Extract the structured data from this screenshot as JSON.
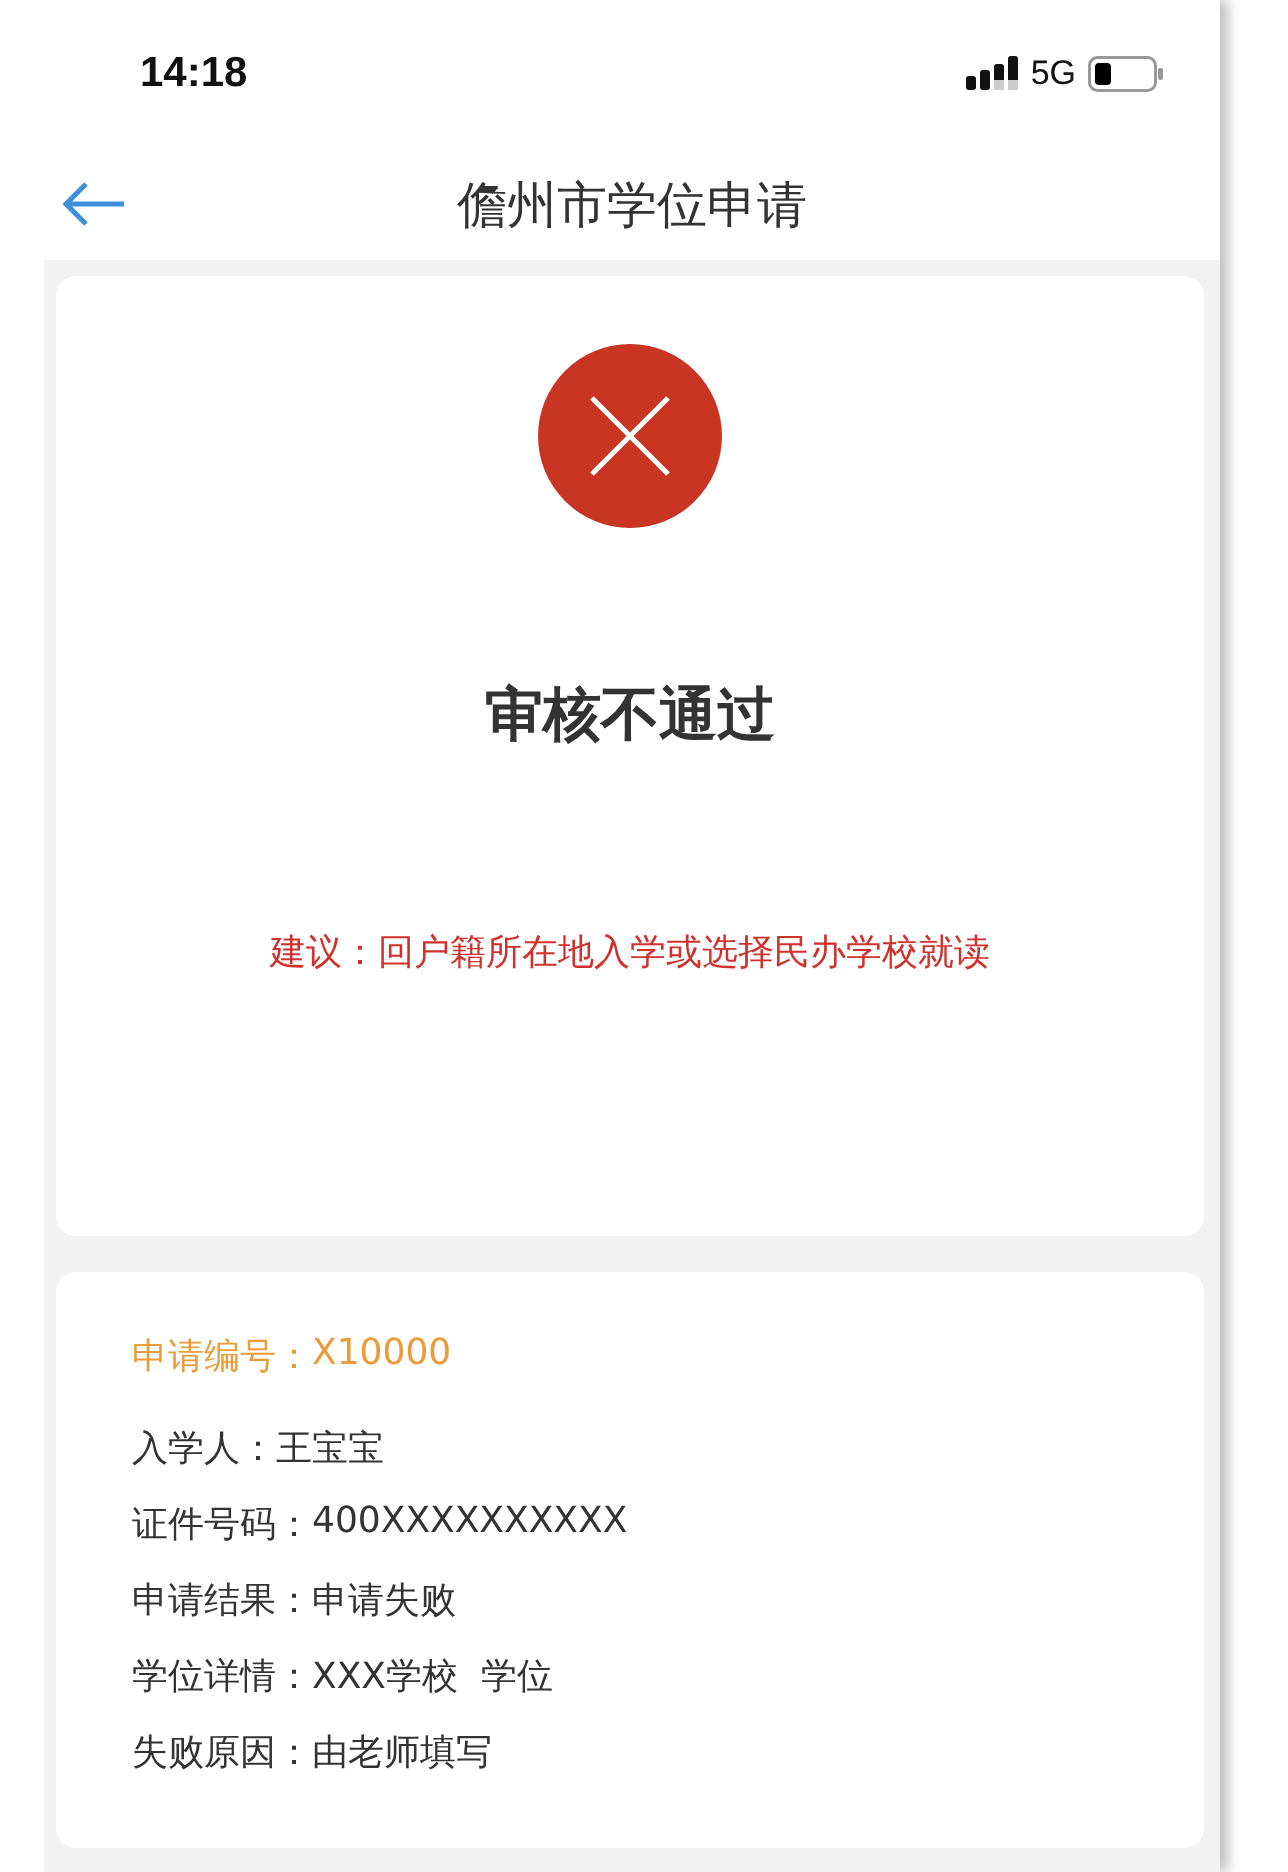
{
  "status_bar": {
    "time": "14:18",
    "network": "5G"
  },
  "nav": {
    "title": "儋州市学位申请"
  },
  "result": {
    "approved": false,
    "title": "审核不通过",
    "suggestion": "建议：回户籍所在地入学或选择民办学校就读"
  },
  "details": {
    "number": {
      "label": "申请编号：",
      "value": "X10000"
    },
    "rows": [
      {
        "label": "入学人：",
        "value": "王宝宝"
      },
      {
        "label": "证件号码：",
        "value": "400XXXXXXXXXX"
      },
      {
        "label": "申请结果：",
        "value": "申请失败"
      },
      {
        "label": "学位详情：",
        "value": "XXX学校  学位"
      },
      {
        "label": "失败原因：",
        "value": "由老师填写"
      }
    ]
  }
}
